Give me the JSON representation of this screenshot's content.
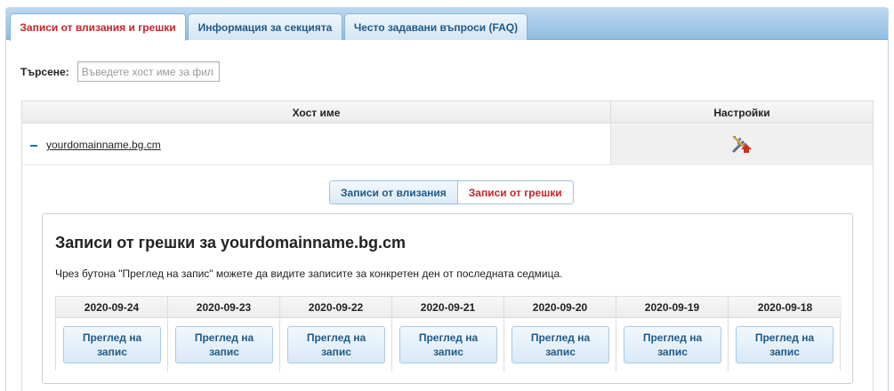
{
  "tabs": [
    {
      "label": "Записи от влизания и грешки",
      "active": true
    },
    {
      "label": "Информация за секцията",
      "active": false
    },
    {
      "label": "Често задавани въпроси (FAQ)",
      "active": false
    }
  ],
  "search": {
    "label": "Търсене:",
    "placeholder": "Въведете хост име за фил",
    "value": ""
  },
  "table": {
    "headers": {
      "host": "Хост име",
      "settings": "Настройки"
    },
    "row": {
      "host": "yourdomainname.bg.cm",
      "settings_icon": "tools-upload-icon"
    }
  },
  "log_tabs": {
    "access": "Записи от влизания",
    "error": "Записи от грешки",
    "active": "error"
  },
  "panel": {
    "title": "Записи от грешки за yourdomainname.bg.cm",
    "description": "Чрез бутона \"Преглед на запис\" можете да видите записите за конкретен ден от последната седмица.",
    "view_label": "Преглед на запис",
    "dates": [
      "2020-09-24",
      "2020-09-23",
      "2020-09-22",
      "2020-09-21",
      "2020-09-20",
      "2020-09-19",
      "2020-09-18"
    ]
  },
  "colors": {
    "accent_red": "#c0262c",
    "tab_blue": "#1f5a88",
    "button_bg": "#dceaf6"
  }
}
